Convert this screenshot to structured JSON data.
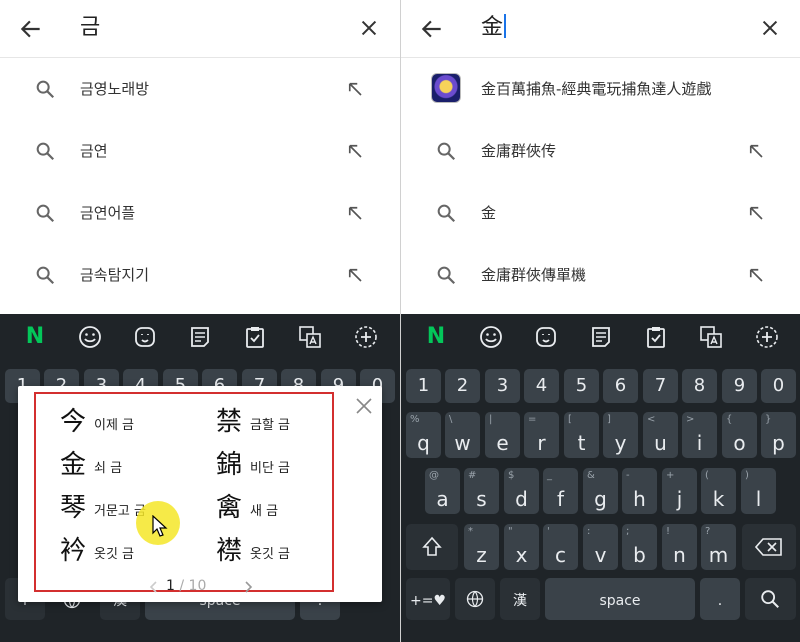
{
  "left": {
    "query": "금",
    "suggestions": [
      "금영노래방",
      "금연",
      "금연어플",
      "금속탐지기"
    ],
    "keyboard": {
      "numbers": [
        "1",
        "2",
        "3",
        "4",
        "5",
        "6",
        "7",
        "8",
        "9",
        "0"
      ],
      "bottom_left_label": "+",
      "hanja_label": "漢",
      "space_label": "space",
      "period_label": "."
    },
    "hanja_popup": {
      "candidates": [
        {
          "hanja": "今",
          "meaning": "이제 금"
        },
        {
          "hanja": "禁",
          "meaning": "금할 금"
        },
        {
          "hanja": "金",
          "meaning": "쇠 금"
        },
        {
          "hanja": "錦",
          "meaning": "비단 금"
        },
        {
          "hanja": "琴",
          "meaning": "거문고 금"
        },
        {
          "hanja": "禽",
          "meaning": "새 금"
        },
        {
          "hanja": "衿",
          "meaning": "옷깃 금"
        },
        {
          "hanja": "襟",
          "meaning": "옷깃 금"
        }
      ],
      "page_current": "1",
      "page_total": "/ 10"
    }
  },
  "right": {
    "query": "金",
    "suggestions": [
      "金百萬捕魚-經典電玩捕魚達人遊戲",
      "金庸群俠传",
      "金",
      "金庸群俠傳單機"
    ],
    "keyboard": {
      "numbers": [
        "1",
        "2",
        "3",
        "4",
        "5",
        "6",
        "7",
        "8",
        "9",
        "0"
      ],
      "row1": [
        {
          "key": "q",
          "sub": "%"
        },
        {
          "key": "w",
          "sub": "\\"
        },
        {
          "key": "e",
          "sub": "|"
        },
        {
          "key": "r",
          "sub": "="
        },
        {
          "key": "t",
          "sub": "["
        },
        {
          "key": "y",
          "sub": "]"
        },
        {
          "key": "u",
          "sub": "<"
        },
        {
          "key": "i",
          "sub": ">"
        },
        {
          "key": "o",
          "sub": "{"
        },
        {
          "key": "p",
          "sub": "}"
        }
      ],
      "row2": [
        {
          "key": "a",
          "sub": "@"
        },
        {
          "key": "s",
          "sub": "#"
        },
        {
          "key": "d",
          "sub": "$"
        },
        {
          "key": "f",
          "sub": "_"
        },
        {
          "key": "g",
          "sub": "&"
        },
        {
          "key": "h",
          "sub": "-"
        },
        {
          "key": "j",
          "sub": "+"
        },
        {
          "key": "k",
          "sub": "("
        },
        {
          "key": "l",
          "sub": ")"
        }
      ],
      "row3": [
        {
          "key": "z",
          "sub": "*"
        },
        {
          "key": "x",
          "sub": "\""
        },
        {
          "key": "c",
          "sub": "'"
        },
        {
          "key": "v",
          "sub": ":"
        },
        {
          "key": "b",
          "sub": ";"
        },
        {
          "key": "n",
          "sub": "!"
        },
        {
          "key": "m",
          "sub": "?"
        }
      ],
      "symbols_label": "+=♥",
      "hanja_label": "漢",
      "space_label": "space",
      "period_label": "."
    }
  },
  "colors": {
    "keyboard_bg": "#1f2428",
    "key_bg": "#3a4249",
    "naver_green": "#03c75a",
    "highlight_frame": "#d32f2f",
    "cursor_highlight": "#f5e628"
  },
  "icons": [
    "back-arrow-icon",
    "clear-icon",
    "search-icon",
    "fill-arrow-icon",
    "naver-icon",
    "emoji-icon",
    "sticker-icon",
    "memo-icon",
    "clipboard-icon",
    "translate-icon",
    "more-icon",
    "shift-icon",
    "backspace-icon",
    "globe-icon",
    "search-key-icon",
    "close-icon",
    "chevron-left-icon",
    "chevron-right-icon",
    "cursor-icon"
  ]
}
